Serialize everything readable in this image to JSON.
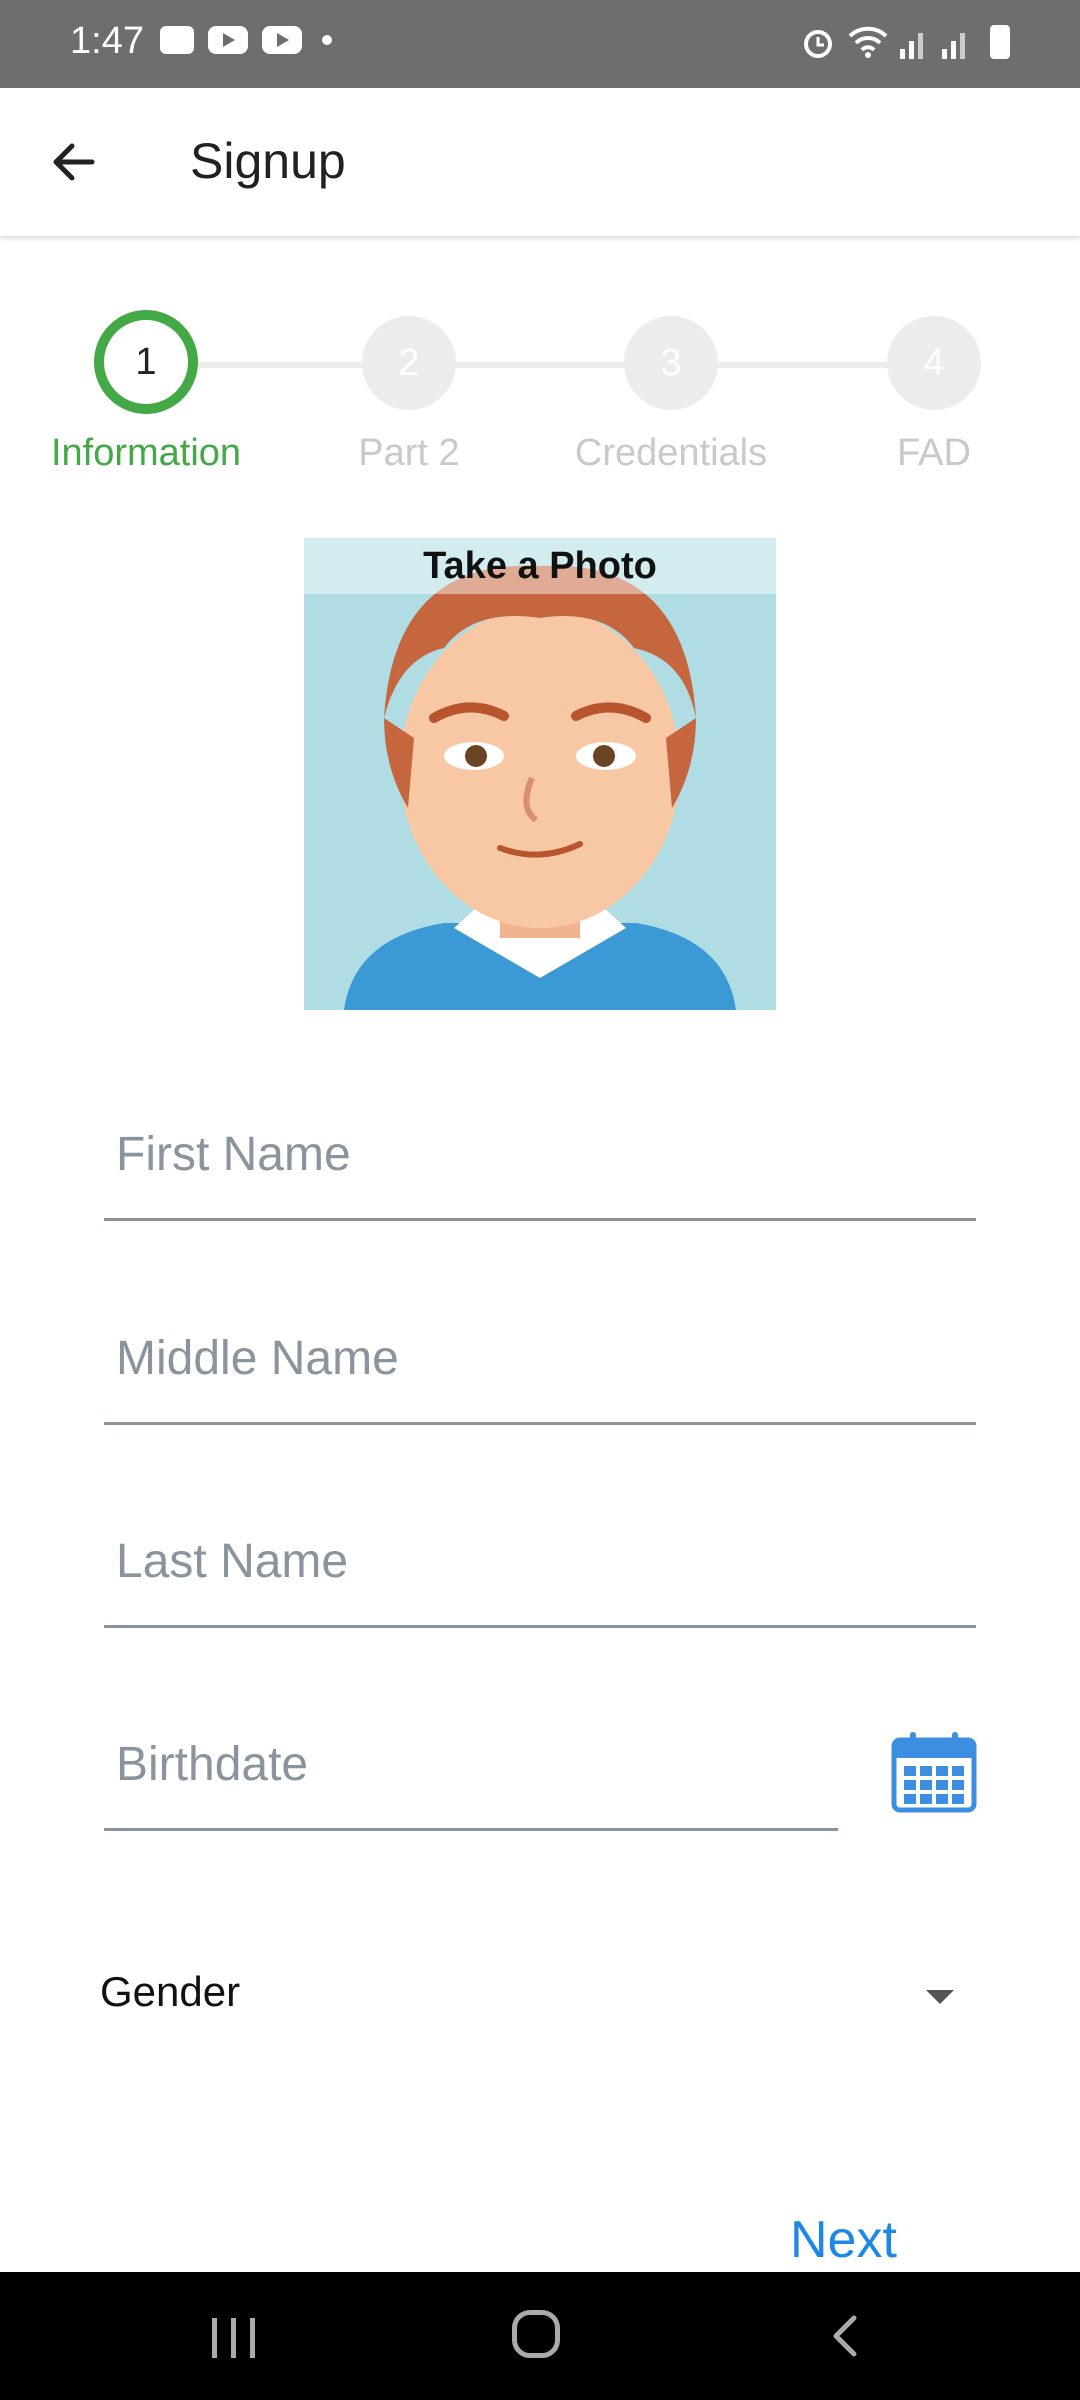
{
  "status_bar": {
    "time": "1:47"
  },
  "app_bar": {
    "title": "Signup"
  },
  "stepper": {
    "steps": [
      {
        "number": "1",
        "label": "Information"
      },
      {
        "number": "2",
        "label": "Part 2"
      },
      {
        "number": "3",
        "label": "Credentials"
      },
      {
        "number": "4",
        "label": "FAD"
      }
    ],
    "active_step": 1
  },
  "photo": {
    "caption": "Take a Photo"
  },
  "form": {
    "first_name_placeholder": "First Name",
    "middle_name_placeholder": "Middle Name",
    "last_name_placeholder": "Last Name",
    "birthdate_placeholder": "Birthdate",
    "gender_label": "Gender"
  },
  "actions": {
    "next_label": "Next"
  },
  "colors": {
    "accent_green": "#43a846",
    "link_blue": "#1e88e5",
    "status_bar": "#6e6e6e"
  }
}
